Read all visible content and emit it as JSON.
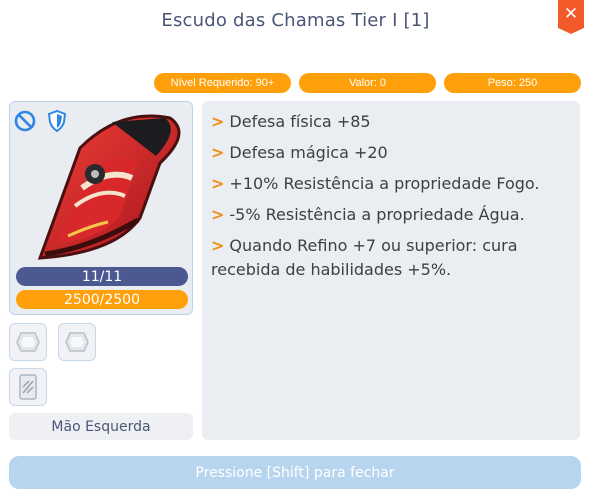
{
  "window": {
    "title": "Escudo das Chamas Tier I [1]",
    "close_symbol": "✕"
  },
  "stats": {
    "level": "Nível Requerido: 90+",
    "value": "Valor: 0",
    "weight": "Peso: 250"
  },
  "item": {
    "durability": "11/11",
    "hp": "2500/2500",
    "slot_name": "Mão Esquerda",
    "badges": [
      "no-trade-icon",
      "shield-type-icon"
    ],
    "card_slots": [
      "card-slot-1-icon",
      "card-slot-2-icon",
      "card-slot-3-icon"
    ]
  },
  "effects": [
    "Defesa física +85",
    "Defesa mágica +20",
    "+10% Resistência a propriedade Fogo.",
    "-5% Resistência a propriedade Água.",
    "Quando Refino +7 ou superior: cura recebida de habilidades +5%."
  ],
  "effect_arrow": ">",
  "footer": {
    "hint": "Pressione [Shift] para fechar"
  },
  "colors": {
    "accent": "#ff9f0a",
    "durability_bar": "#4b5990",
    "close": "#f25a2a",
    "footer": "#b7d5ee"
  }
}
